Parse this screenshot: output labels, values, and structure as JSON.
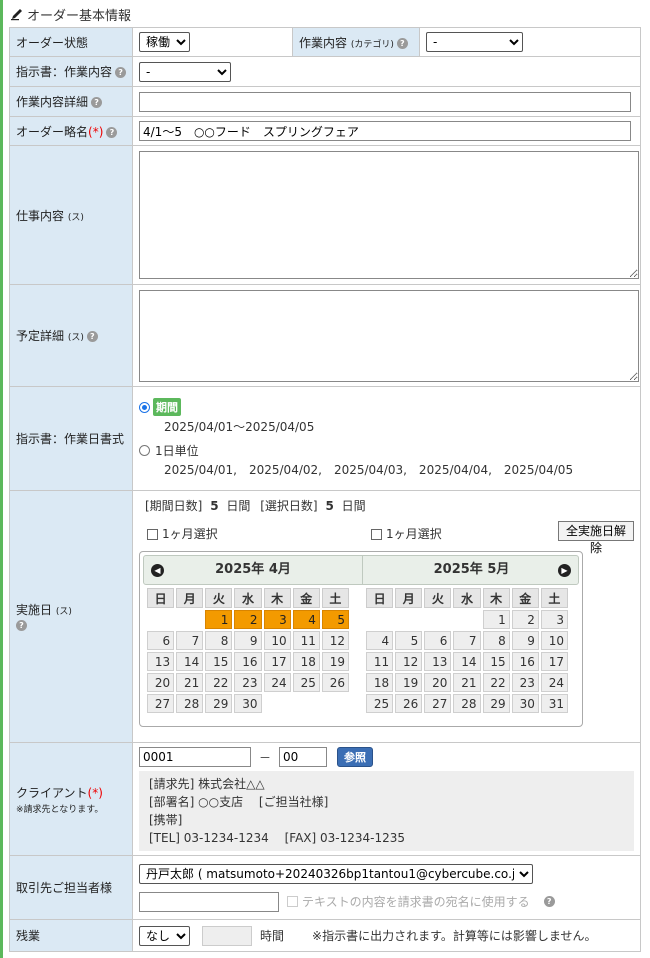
{
  "section": {
    "title": "オーダー基本情報"
  },
  "order_status": {
    "label": "オーダー状態",
    "value": "稼働"
  },
  "work_content": {
    "label": "作業内容",
    "sub": "(カテゴリ)",
    "value": "-"
  },
  "instruction_work": {
    "label": "指示書：作業内容",
    "value": "-"
  },
  "work_detail": {
    "label": "作業内容詳細",
    "value": ""
  },
  "order_abbr": {
    "label": "オーダー略名",
    "req": "(*)",
    "value": "4/1～5　○○フード　スプリングフェア"
  },
  "job_content": {
    "label": "仕事内容",
    "sub": "(ス)"
  },
  "plan_detail": {
    "label": "予定詳細",
    "sub": "(ス)"
  },
  "date_format": {
    "label": "指示書：作業日書式",
    "opt1_label": "期間",
    "opt1_text": "2025/04/01～2025/04/05",
    "opt2_label": "1日単位",
    "opt2_text": "2025/04/01,　2025/04/02,　2025/04/03,　2025/04/04,　2025/04/05"
  },
  "exec_date": {
    "label": "実施日",
    "sub": "(ス)",
    "period_label": "[期間日数]",
    "period_num": "5",
    "period_unit": "日間",
    "sel_label": "[選択日数]",
    "sel_num": "5",
    "sel_unit": "日間",
    "month_select": "1ヶ月選択",
    "clear_btn": "全実施日解除"
  },
  "calendar": {
    "weekdays": [
      "日",
      "月",
      "火",
      "水",
      "木",
      "金",
      "土"
    ],
    "months": [
      {
        "title": "2025年 4月",
        "weeks": [
          [
            "",
            "",
            "1",
            "2",
            "3",
            "4",
            "5"
          ],
          [
            "6",
            "7",
            "8",
            "9",
            "10",
            "11",
            "12"
          ],
          [
            "13",
            "14",
            "15",
            "16",
            "17",
            "18",
            "19"
          ],
          [
            "20",
            "21",
            "22",
            "23",
            "24",
            "25",
            "26"
          ],
          [
            "27",
            "28",
            "29",
            "30",
            "",
            "",
            ""
          ]
        ],
        "selected": [
          "1",
          "2",
          "3",
          "4",
          "5"
        ]
      },
      {
        "title": "2025年 5月",
        "weeks": [
          [
            "",
            "",
            "",
            "",
            "1",
            "2",
            "3"
          ],
          [
            "4",
            "5",
            "6",
            "7",
            "8",
            "9",
            "10"
          ],
          [
            "11",
            "12",
            "13",
            "14",
            "15",
            "16",
            "17"
          ],
          [
            "18",
            "19",
            "20",
            "21",
            "22",
            "23",
            "24"
          ],
          [
            "25",
            "26",
            "27",
            "28",
            "29",
            "30",
            "31"
          ]
        ],
        "selected": []
      }
    ]
  },
  "client": {
    "label": "クライアント",
    "req": "(*)",
    "note": "※請求先となります。",
    "code1": "0001",
    "dash": "－",
    "code2": "00",
    "ref_btn": "参照",
    "lines": [
      "[請求先] 株式会社△△",
      "[部署名] ○○支店　 [ご担当社様]",
      "[携帯]",
      "[TEL] 03-1234-1234　 [FAX] 03-1234-1235"
    ]
  },
  "contact": {
    "label": "取引先ご担当者様",
    "value": "丹戸太郎 ( matsumoto+20240326bp1tantou1@cybercube.co.jp)",
    "text_value": "",
    "use_label": "テキストの内容を請求書の宛名に使用する"
  },
  "overtime": {
    "label": "残業",
    "value": "なし",
    "unit": "時間",
    "note": "※指示書に出力されます。計算等には影響しません。"
  }
}
